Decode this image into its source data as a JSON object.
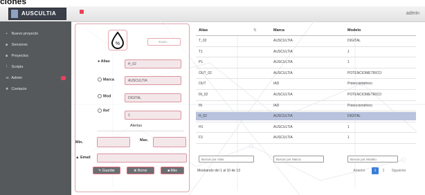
{
  "page": {
    "heading": "ciones"
  },
  "topbar": {
    "logo_text": "AUSCULTIA",
    "user": "admin"
  },
  "sidebar": {
    "items": [
      {
        "icon": "+",
        "label": "Nuevo proyecto"
      },
      {
        "icon": "■",
        "label": "Sensores"
      },
      {
        "icon": "■",
        "label": "Proyectos"
      },
      {
        "icon": "└",
        "label": "Scripts"
      },
      {
        "icon": "≪",
        "label": "Admin"
      },
      {
        "icon": "✚",
        "label": "Contacto"
      }
    ]
  },
  "form": {
    "file_button": "Exam...",
    "alias_label": "Alias",
    "alias_value": "H_02",
    "marca_label": "Marca",
    "marca_value": "AUSCULTIA",
    "mod_label": "Mod",
    "mod_value": "DIGITAL",
    "ref_label": "Ref",
    "ref_value": "1",
    "alertas_label": "Alertas",
    "min_label": "Min.",
    "min_value": "",
    "max_label": "Max.",
    "max_value": "",
    "email_label": "Email",
    "email_value": "",
    "save_label": "Guardar",
    "delete_label": "Borrar",
    "more_label": "Más"
  },
  "table": {
    "headers": [
      "Alias",
      "Marca",
      "Modelo"
    ],
    "rows": [
      {
        "alias": "T_02",
        "marca": "AUSCULTIA",
        "modelo": "DIGITAL"
      },
      {
        "alias": "T1",
        "marca": "AUSCULTIA",
        "modelo": "1"
      },
      {
        "alias": "P1",
        "marca": "AUSCULTIA",
        "modelo": "1"
      },
      {
        "alias": "OUT_02",
        "marca": "AUSCULTIA",
        "modelo": "POTENCIOMETRICO"
      },
      {
        "alias": "OUT",
        "marca": "IAD",
        "modelo": "Potenciométrico"
      },
      {
        "alias": "IN_02",
        "marca": "AUSCULTIA",
        "modelo": "POTENCIOMETRICO"
      },
      {
        "alias": "IN",
        "marca": "IAD",
        "modelo": "Potenciométrico"
      },
      {
        "alias": "H_02",
        "marca": "AUSCULTIA",
        "modelo": "DIGITAL"
      },
      {
        "alias": "H1",
        "marca": "AUSCULTIA",
        "modelo": "1"
      },
      {
        "alias": "F3",
        "marca": "AUSCULTIA",
        "modelo": "1"
      }
    ],
    "selected_index": 7,
    "filters": {
      "alias_placeholder": "Buscar por Alias",
      "marca_placeholder": "Buscar por Marca",
      "modelo_placeholder": "Buscar por Modelo"
    },
    "info": "Mostrando del 1 al 10 de 13",
    "pager": {
      "prev": "Anterior",
      "page1": "1",
      "page2": "2",
      "next": "Siguiente"
    }
  },
  "colors": {
    "accent": "#e8415a",
    "sidebar": "#55595c",
    "page_active": "#3b7dd8",
    "selected_row": "#b9c3dd",
    "button": "#6b6f73"
  },
  "icons": [
    "drop-percent-icon",
    "menu-toggle-icon",
    "email-icon",
    "save-icon",
    "trash-icon",
    "more-icon"
  ]
}
